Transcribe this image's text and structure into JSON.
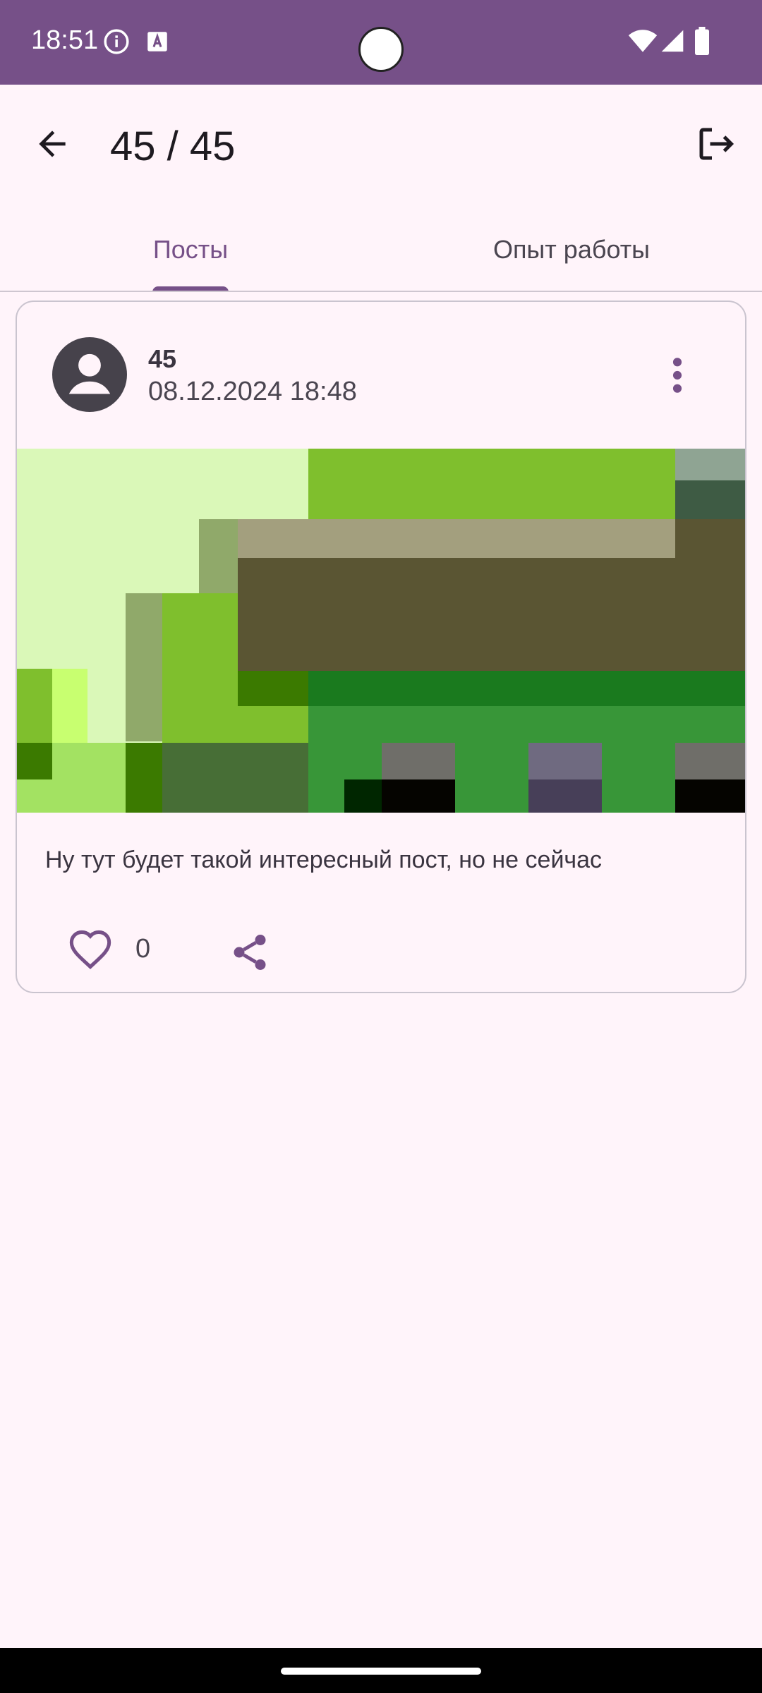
{
  "status_bar": {
    "time": "18:51",
    "icons": [
      "info-icon",
      "translate-icon",
      "wifi-icon",
      "signal-icon",
      "battery-icon"
    ]
  },
  "app_bar": {
    "title": "45 / 45",
    "back_icon": "arrow-back-icon",
    "logout_icon": "logout-icon"
  },
  "tabs": [
    {
      "label": "Посты",
      "selected": true
    },
    {
      "label": "Опыт работы",
      "selected": false
    }
  ],
  "post": {
    "author": "45",
    "date": "08.12.2024 18:48",
    "text": "Ну тут будет такой интересный пост, но не сейчас",
    "likes": "0",
    "image": "pixelated-green-image"
  },
  "colors": {
    "primary": "#765088",
    "background": "#FFF4FA",
    "avatar": "#46424B"
  }
}
